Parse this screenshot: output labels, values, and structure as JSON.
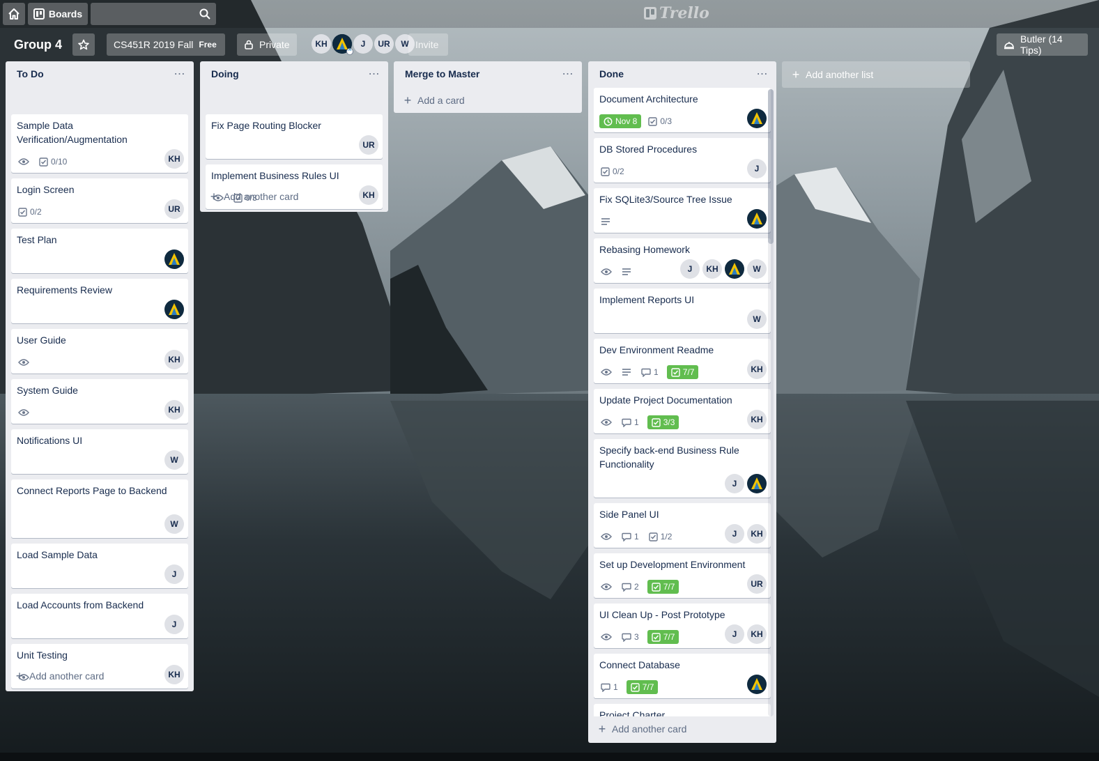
{
  "topbar": {
    "boards_label": "Boards",
    "search_placeholder": "",
    "logo_text": "Trello"
  },
  "board": {
    "title": "Group 4",
    "team_name": "CS451R 2019 Fall",
    "team_plan": "Free",
    "visibility": "Private",
    "members": [
      "KH",
      "",
      "J",
      "UR",
      "W"
    ],
    "invite_label": "Invite",
    "butler_label": "Butler (14 Tips)"
  },
  "lists": [
    {
      "title": "To Do",
      "add_label": "Add another card",
      "cards": [
        {
          "title": "Sample Data Verification/Augmentation",
          "watch": true,
          "checklist": "0/10",
          "members": [
            "KH"
          ]
        },
        {
          "title": "Login Screen",
          "checklist": "0/2",
          "members": [
            "UR"
          ]
        },
        {
          "title": "Test Plan",
          "members": [
            "avatar"
          ]
        },
        {
          "title": "Requirements Review",
          "members": [
            "avatar"
          ]
        },
        {
          "title": "User Guide",
          "watch": true,
          "members": [
            "KH"
          ]
        },
        {
          "title": "System Guide",
          "watch": true,
          "members": [
            "KH"
          ]
        },
        {
          "title": "Notifications UI",
          "members": [
            "W"
          ]
        },
        {
          "title": "Connect Reports Page to Backend",
          "members": [
            "W"
          ]
        },
        {
          "title": "Load Sample Data",
          "members": [
            "J"
          ]
        },
        {
          "title": "Load Accounts from Backend",
          "members": [
            "J"
          ]
        },
        {
          "title": "Unit Testing",
          "watch": true,
          "members": [
            "KH"
          ]
        }
      ]
    },
    {
      "title": "Doing",
      "add_label": "Add another card",
      "cards": [
        {
          "title": "Fix Page Routing Blocker",
          "members": [
            "UR"
          ]
        },
        {
          "title": "Implement Business Rules UI",
          "watch": true,
          "checklist": "0/3",
          "members": [
            "KH"
          ]
        }
      ]
    },
    {
      "title": "Merge to Master",
      "add_label": "Add a card",
      "cards": []
    },
    {
      "title": "Done",
      "add_label": "Add another card",
      "cards": [
        {
          "title": "Document Architecture",
          "due": "Nov 8",
          "checklist": "0/3",
          "members": [
            "avatar"
          ]
        },
        {
          "title": "DB Stored Procedures",
          "checklist": "0/2",
          "members": [
            "J"
          ]
        },
        {
          "title": "Fix SQLite3/Source Tree Issue",
          "description": true,
          "members": [
            "avatar"
          ]
        },
        {
          "title": "Rebasing Homework",
          "watch": true,
          "description": true,
          "members": [
            "J",
            "KH",
            "avatar",
            "W"
          ]
        },
        {
          "title": "Implement Reports UI",
          "members": [
            "W"
          ]
        },
        {
          "title": "Dev Environment Readme",
          "watch": true,
          "description": true,
          "comments": "1",
          "checklist_done": "7/7",
          "members": [
            "KH"
          ]
        },
        {
          "title": "Update Project Documentation",
          "watch": true,
          "comments": "1",
          "checklist_done": "3/3",
          "members": [
            "KH"
          ]
        },
        {
          "title": "Specify back-end Business Rule Functionality",
          "members": [
            "J",
            "avatar"
          ]
        },
        {
          "title": "Side Panel UI",
          "watch": true,
          "comments": "1",
          "checklist": "1/2",
          "members": [
            "J",
            "KH"
          ]
        },
        {
          "title": "Set up Development Environment",
          "watch": true,
          "comments": "2",
          "checklist_done": "7/7",
          "members": [
            "UR"
          ]
        },
        {
          "title": "UI Clean Up - Post Prototype",
          "watch": true,
          "comments": "3",
          "checklist_done": "7/7",
          "members": [
            "J",
            "KH"
          ]
        },
        {
          "title": "Connect Database",
          "comments": "1",
          "checklist_done": "7/7",
          "members": [
            "avatar"
          ]
        },
        {
          "title": "Project Charter"
        }
      ]
    }
  ],
  "add_list_label": "Add another list",
  "colors": {
    "list_bg": "#ebecf0",
    "done_badge": "#61bd4f",
    "text": "#172b4d",
    "muted": "#5e6c84"
  }
}
